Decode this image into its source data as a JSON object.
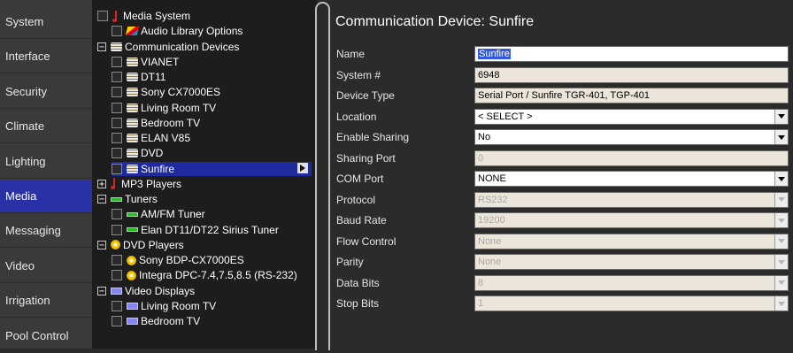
{
  "nav": {
    "items": [
      {
        "label": "System"
      },
      {
        "label": "Interface"
      },
      {
        "label": "Security"
      },
      {
        "label": "Climate"
      },
      {
        "label": "Lighting"
      },
      {
        "label": "Media",
        "active": true
      },
      {
        "label": "Messaging"
      },
      {
        "label": "Video"
      },
      {
        "label": "Irrigation"
      },
      {
        "label": "Pool Control"
      }
    ]
  },
  "tree": {
    "nodes": [
      {
        "label": "Media System",
        "level": 0,
        "control": "checkbox",
        "icon": "music-note-icon"
      },
      {
        "label": "Audio Library Options",
        "level": 1,
        "control": "checkbox",
        "icon": "audio-library-icon"
      },
      {
        "label": "Communication Devices",
        "level": 0,
        "control": "collapse",
        "icon": "device-icon"
      },
      {
        "label": "VIANET",
        "level": 1,
        "control": "checkbox",
        "icon": "device-icon"
      },
      {
        "label": "DT11",
        "level": 1,
        "control": "checkbox",
        "icon": "device-icon"
      },
      {
        "label": "Sony CX7000ES",
        "level": 1,
        "control": "checkbox",
        "icon": "device-icon"
      },
      {
        "label": "Living Room TV",
        "level": 1,
        "control": "checkbox",
        "icon": "device-icon"
      },
      {
        "label": "Bedroom TV",
        "level": 1,
        "control": "checkbox",
        "icon": "device-icon"
      },
      {
        "label": "ELAN V85",
        "level": 1,
        "control": "checkbox",
        "icon": "device-icon"
      },
      {
        "label": "DVD",
        "level": 1,
        "control": "checkbox",
        "icon": "device-icon"
      },
      {
        "label": "Sunfire",
        "level": 1,
        "control": "checkbox",
        "icon": "device-icon",
        "selected": true
      },
      {
        "label": "MP3 Players",
        "level": 0,
        "control": "expand",
        "icon": "music-note-icon"
      },
      {
        "label": "Tuners",
        "level": 0,
        "control": "collapse",
        "icon": "tuner-icon"
      },
      {
        "label": "AM/FM Tuner",
        "level": 1,
        "control": "checkbox",
        "icon": "tuner-icon"
      },
      {
        "label": "Elan DT11/DT22 Sirius Tuner",
        "level": 1,
        "control": "checkbox",
        "icon": "tuner-icon"
      },
      {
        "label": "DVD Players",
        "level": 0,
        "control": "collapse",
        "icon": "dvd-icon"
      },
      {
        "label": "Sony BDP-CX7000ES",
        "level": 1,
        "control": "checkbox",
        "icon": "dvd-icon"
      },
      {
        "label": "Integra DPC-7.4,7.5,8.5 (RS-232)",
        "level": 1,
        "control": "checkbox",
        "icon": "dvd-icon"
      },
      {
        "label": "Video Displays",
        "level": 0,
        "control": "collapse",
        "icon": "display-icon"
      },
      {
        "label": "Living Room TV",
        "level": 1,
        "control": "checkbox",
        "icon": "display-icon"
      },
      {
        "label": "Bedroom TV",
        "level": 1,
        "control": "checkbox",
        "icon": "display-icon"
      }
    ]
  },
  "detail": {
    "title": "Communication Device: Sunfire",
    "fields": [
      {
        "label": "Name",
        "value": "Sunfire",
        "kind": "text",
        "state": "editable",
        "highlight": true
      },
      {
        "label": "System #",
        "value": "6948",
        "kind": "text",
        "state": "readonly"
      },
      {
        "label": "Device Type",
        "value": "Serial Port / Sunfire TGR-401, TGP-401",
        "kind": "text",
        "state": "readonly"
      },
      {
        "label": "Location",
        "value": "< SELECT >",
        "kind": "select",
        "state": "editable"
      },
      {
        "label": "Enable Sharing",
        "value": "No",
        "kind": "select",
        "state": "editable"
      },
      {
        "label": "Sharing Port",
        "value": "0",
        "kind": "text",
        "state": "disabled"
      },
      {
        "label": "COM Port",
        "value": "NONE",
        "kind": "select",
        "state": "editable"
      },
      {
        "label": "Protocol",
        "value": "RS232",
        "kind": "select",
        "state": "disabled"
      },
      {
        "label": "Baud Rate",
        "value": "19200",
        "kind": "select",
        "state": "disabled"
      },
      {
        "label": "Flow Control",
        "value": "None",
        "kind": "select",
        "state": "disabled"
      },
      {
        "label": "Parity",
        "value": "None",
        "kind": "select",
        "state": "disabled"
      },
      {
        "label": "Data Bits",
        "value": "8",
        "kind": "select",
        "state": "disabled"
      },
      {
        "label": "Stop Bits",
        "value": "1",
        "kind": "select",
        "state": "disabled"
      }
    ]
  },
  "colors": {
    "nav_active": "#2a31a6",
    "tree_selected": "#1e2a9e",
    "readonly_field": "#ece6da"
  }
}
